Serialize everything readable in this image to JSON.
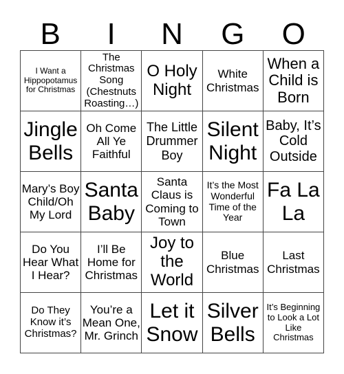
{
  "header": [
    "B",
    "I",
    "N",
    "G",
    "O"
  ],
  "cells": [
    [
      "I Want a Hippopotamus for Christmas",
      "The Christmas Song (Chestnuts Roasting…)",
      "O Holy Night",
      "White Christmas",
      "When a Child is Born"
    ],
    [
      "Jingle Bells",
      "Oh Come All Ye Faithful",
      "The Little Drummer Boy",
      "Silent Night",
      "Baby, It’s Cold Outside"
    ],
    [
      "Mary’s Boy Child/Oh My Lord",
      "Santa Baby",
      "Santa Claus is Coming to Town",
      "It’s the Most Wonderful Time of the Year",
      "Fa La La"
    ],
    [
      "Do You Hear What I Hear?",
      "I’ll Be Home for Christmas",
      "Joy to the World",
      "Blue Christmas",
      "Last Christmas"
    ],
    [
      "Do They Know it’s Christmas?",
      "You’re a Mean One, Mr. Grinch",
      "Let it Snow",
      "Silver Bells",
      "It’s Beginning to Look a Lot Like Christmas"
    ]
  ]
}
